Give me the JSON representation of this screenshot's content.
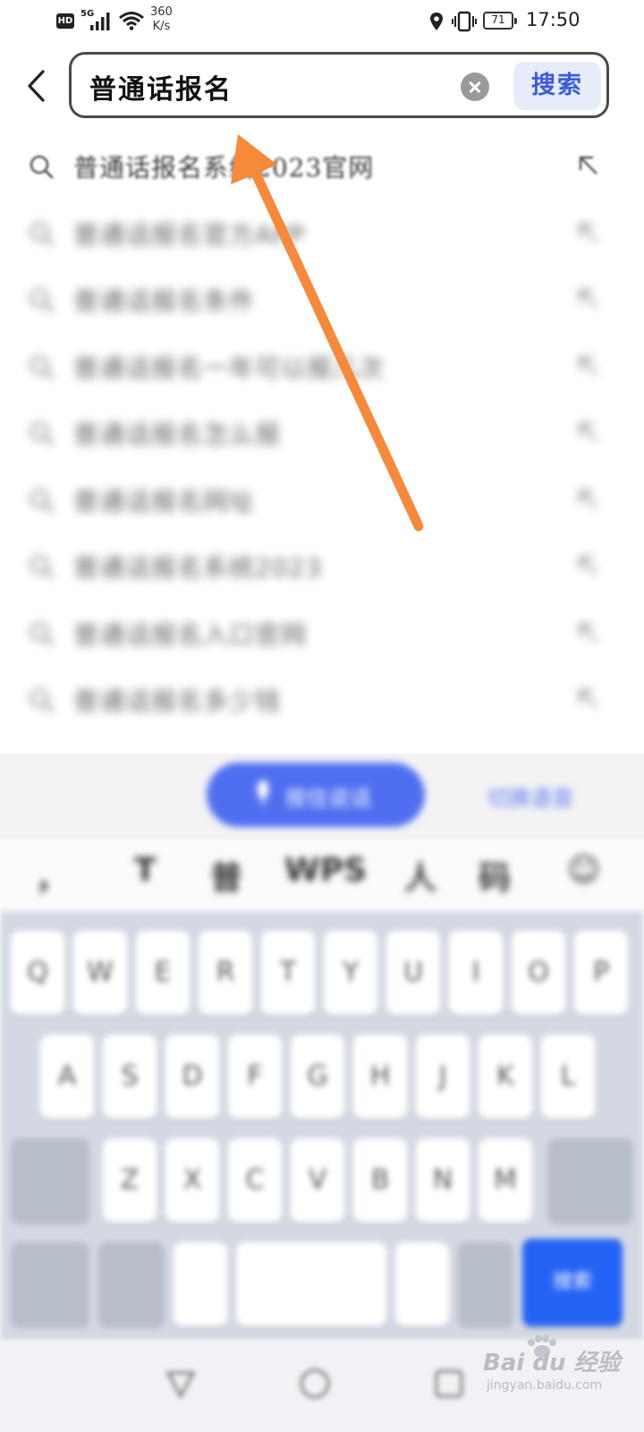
{
  "status_bar": {
    "hd": "HD",
    "network": "5G",
    "speed_value": "360",
    "speed_unit": "K/s",
    "battery": "71",
    "time": "17:50"
  },
  "search": {
    "query": "普通话报名",
    "button_label": "搜索",
    "accent_color": "#3b5bdb"
  },
  "suggestions": [
    {
      "text": "普通话报名系统2023官网"
    },
    {
      "text": "普通话报名官方APP"
    },
    {
      "text": "普通话报名条件"
    },
    {
      "text": "普通话报名一年可以报几次"
    },
    {
      "text": "普通话报名怎么报"
    },
    {
      "text": "普通话报名网址"
    },
    {
      "text": "普通话报名系统2023"
    },
    {
      "text": "普通话报名入口官网"
    },
    {
      "text": "普通话报名多少钱"
    }
  ],
  "voice": {
    "button_label": "按住说话",
    "link_label": "切换语音"
  },
  "keyboard": {
    "candidates": [
      "，",
      "T",
      "普",
      "WPS",
      "人",
      "码",
      "☺"
    ],
    "row1": [
      "Q",
      "W",
      "E",
      "R",
      "T",
      "Y",
      "U",
      "I",
      "O",
      "P"
    ],
    "row2": [
      "A",
      "S",
      "D",
      "F",
      "G",
      "H",
      "J",
      "K",
      "L"
    ],
    "row3": [
      "Z",
      "X",
      "C",
      "V",
      "B",
      "N",
      "M"
    ],
    "enter_label": "搜索",
    "enter_color": "#2563f4"
  },
  "watermark": {
    "brand": "Bai du 经验",
    "url": "jingyan.baidu.com"
  },
  "annotation": {
    "color": "#f7893a"
  }
}
